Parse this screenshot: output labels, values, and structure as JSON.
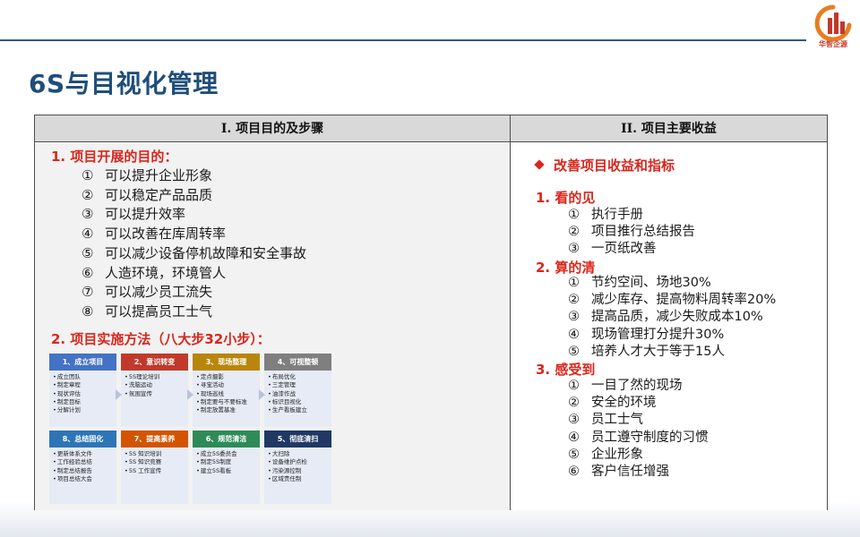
{
  "header": {
    "logo_text": "华智企源",
    "title": "6S与目视化管理"
  },
  "columns": {
    "left_header": "I.    项目目的及步骤",
    "right_header": "II.   项目主要收益"
  },
  "purpose": {
    "title": "1. 项目开展的目的：",
    "items": [
      {
        "num": "①",
        "text": "可以提升企业形象"
      },
      {
        "num": "②",
        "text": "可以稳定产品品质"
      },
      {
        "num": "③",
        "text": "可以提升效率"
      },
      {
        "num": "④",
        "text": "可以改善在库周转率"
      },
      {
        "num": "⑤",
        "text": "可以减少设备停机故障和安全事故"
      },
      {
        "num": "⑥",
        "text": "人造环境，环境管人"
      },
      {
        "num": "⑦",
        "text": "可以减少员工流失"
      },
      {
        "num": "⑧",
        "text": "可以提高员工士气"
      }
    ]
  },
  "method": {
    "title": "2. 项目实施方法（八大步32小步）：",
    "steps": [
      {
        "title": "1、成立项目",
        "color": "#4472c4",
        "items": [
          "成立团队",
          "制定章程",
          "现状评估",
          "制定目标",
          "分解计划"
        ]
      },
      {
        "title": "2、意识转变",
        "color": "#c0392b",
        "items": [
          "5S理论培训",
          "洗脑运动",
          "氛围宣传"
        ]
      },
      {
        "title": "3、现场整理",
        "color": "#b8860b",
        "items": [
          "定点摄影",
          "寻宝活动",
          "现场巡线",
          "制定要与不要标准",
          "制定放置基准"
        ]
      },
      {
        "title": "4、可视整顿",
        "color": "#7f7f7f",
        "items": [
          "布局优化",
          "三定管理",
          "油漆作战",
          "标识目视化",
          "生产看板建立"
        ]
      },
      {
        "title": "8、总结固化",
        "color": "#2e75b6",
        "items": [
          "更新体系文件",
          "工作经验总结",
          "制定总结报告",
          "项目总结大会"
        ]
      },
      {
        "title": "7、提高素养",
        "color": "#d35400",
        "items": [
          "5S 知识培训",
          "5S 知识竞赛",
          "5S 工作宣传"
        ]
      },
      {
        "title": "6、规范清洁",
        "color": "#2e8b57",
        "items": [
          "成立5S委员会",
          "制定5S制度",
          "建立5S看板"
        ]
      },
      {
        "title": "5、彻底清扫",
        "color": "#1f3864",
        "items": [
          "大扫除",
          "设备维护点检",
          "污染源控制",
          "区域责任制"
        ]
      }
    ]
  },
  "benefits": {
    "title": "改善项目收益和指标",
    "groups": [
      {
        "title": "1.  看的见",
        "items": [
          {
            "num": "①",
            "text": "执行手册"
          },
          {
            "num": "②",
            "text": "项目推行总结报告"
          },
          {
            "num": "③",
            "text": "一页纸改善"
          }
        ]
      },
      {
        "title": "2.  算的清",
        "items": [
          {
            "num": "①",
            "text": "节约空间、场地30%"
          },
          {
            "num": "②",
            "text": "减少库存、提高物料周转率20%"
          },
          {
            "num": "③",
            "text": "提高品质，减少失败成本10%"
          },
          {
            "num": "④",
            "text": "现场管理打分提升30%"
          },
          {
            "num": "⑤",
            "text": "培养人才大于等于15人"
          }
        ]
      },
      {
        "title": "3.  感受到",
        "items": [
          {
            "num": "①",
            "text": "一目了然的现场"
          },
          {
            "num": "②",
            "text": "安全的环境"
          },
          {
            "num": "③",
            "text": "员工士气"
          },
          {
            "num": "④",
            "text": "员工遵守制度的习惯"
          },
          {
            "num": "⑤",
            "text": "企业形象"
          },
          {
            "num": "⑥",
            "text": "客户信任增强"
          }
        ]
      }
    ]
  }
}
